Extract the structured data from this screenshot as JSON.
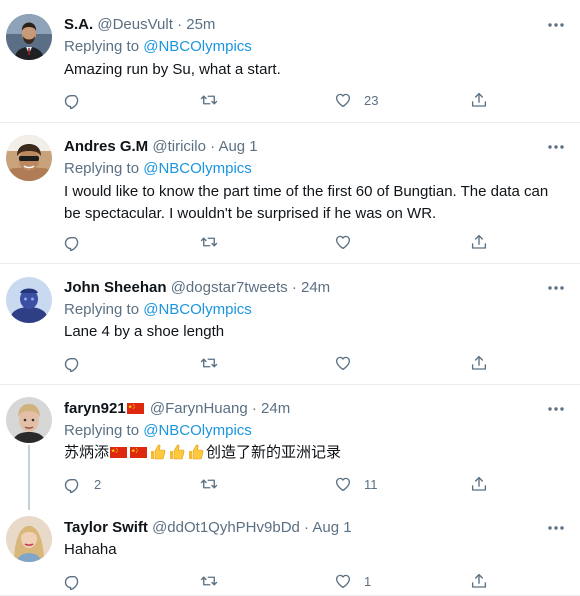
{
  "replying_label": "Replying to",
  "tweets": [
    {
      "display_name": "S.A.",
      "handle": "@DeusVult",
      "time": "25m",
      "reply_to": "@NBCOlympics",
      "text": "Amazing run by Su, what a start.",
      "counts": {
        "reply": "",
        "retweet": "",
        "like": "23",
        "share": ""
      }
    },
    {
      "display_name": "Andres G.M",
      "handle": "@tiricilo",
      "time": "Aug 1",
      "reply_to": "@NBCOlympics",
      "text": "I would like to know the part time of the first 60 of Bungtian.  The data can be spectacular.  I wouldn't be surprised if he was on WR.",
      "counts": {
        "reply": "",
        "retweet": "",
        "like": "",
        "share": ""
      }
    },
    {
      "display_name": "John Sheehan",
      "handle": "@dogstar7tweets",
      "time": "24m",
      "reply_to": "@NBCOlympics",
      "text": "Lane 4 by a shoe length",
      "counts": {
        "reply": "",
        "retweet": "",
        "like": "",
        "share": ""
      }
    },
    {
      "display_name": "faryn921",
      "handle": "@FarynHuang",
      "time": "24m",
      "reply_to": "@NBCOlympics",
      "text_prefix": "苏炳添",
      "text_suffix": "创造了新的亚洲记录",
      "counts": {
        "reply": "2",
        "retweet": "",
        "like": "11",
        "share": ""
      }
    },
    {
      "display_name": "Taylor Swift",
      "handle": "@ddOt1QyhPHv9bDd",
      "time": "Aug 1",
      "text": "Hahaha",
      "counts": {
        "reply": "",
        "retweet": "",
        "like": "1",
        "share": ""
      }
    }
  ],
  "colors": {
    "secondary_text": "#5b7083",
    "link": "#1b95e0",
    "divider": "#ebeef0"
  },
  "icons": {
    "reply": "reply-icon",
    "retweet": "retweet-icon",
    "like": "like-icon",
    "share": "share-icon",
    "more": "more-options-icon"
  }
}
